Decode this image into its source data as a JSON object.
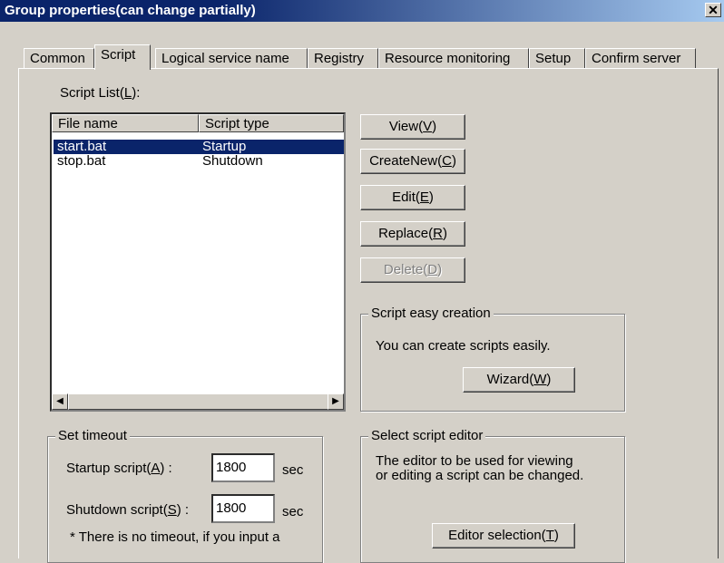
{
  "window": {
    "title": "Group properties(can change partially)"
  },
  "tabs": [
    {
      "label": "Common"
    },
    {
      "label": "Script"
    },
    {
      "label": "Logical service name"
    },
    {
      "label": "Registry"
    },
    {
      "label": "Resource monitoring"
    },
    {
      "label": "Setup"
    },
    {
      "label": "Confirm server"
    }
  ],
  "script_list": {
    "label": "Script List(",
    "mnemonic": "L",
    "label_end": "):",
    "columns": [
      "File name",
      "Script type"
    ],
    "rows": [
      {
        "file": "start.bat",
        "type": "Startup",
        "selected": true
      },
      {
        "file": "stop.bat",
        "type": "Shutdown",
        "selected": false
      }
    ]
  },
  "buttons": {
    "view": {
      "text": "View(",
      "key": "V",
      "end": ")"
    },
    "create_new": {
      "text": "CreateNew(",
      "key": "C",
      "end": ")"
    },
    "edit": {
      "text": "Edit(",
      "key": "E",
      "end": ")"
    },
    "replace": {
      "text": "Replace(",
      "key": "R",
      "end": ")"
    },
    "delete": {
      "text": "Delete(",
      "key": "D",
      "end": ")"
    }
  },
  "easy_creation": {
    "title": "Script easy creation",
    "text": "You can create scripts easily.",
    "wizard": {
      "text": "Wizard(",
      "key": "W",
      "end": ")"
    }
  },
  "timeout": {
    "title": "Set timeout",
    "startup_label": "Startup script(",
    "startup_key": "A",
    "startup_end": ") :",
    "startup_value": "1800",
    "shutdown_label": "Shutdown script(",
    "shutdown_key": "S",
    "shutdown_end": ") :",
    "shutdown_value": "1800",
    "unit": "sec",
    "note": "* There is no timeout, if you input a"
  },
  "editor": {
    "title": "Select script editor",
    "text1": "The editor to be used for viewing",
    "text2": "or editing a script can be changed.",
    "button": {
      "text": "Editor selection(",
      "key": "T",
      "end": ")"
    }
  }
}
